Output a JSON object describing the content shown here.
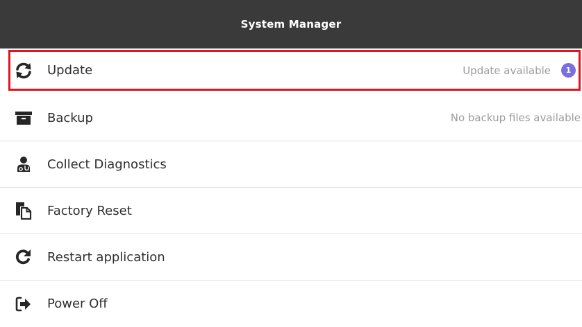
{
  "header": {
    "title": "System Manager"
  },
  "menu": {
    "items": [
      {
        "label": "Update",
        "status": "Update available",
        "badge": "1",
        "icon": "refresh-icon",
        "selected": true
      },
      {
        "label": "Backup",
        "status": "No backup files available",
        "icon": "archive-box-icon"
      },
      {
        "label": "Collect Diagnostics",
        "icon": "doctor-icon"
      },
      {
        "label": "Factory Reset",
        "icon": "copy-files-icon"
      },
      {
        "label": "Restart application",
        "icon": "restart-icon"
      },
      {
        "label": "Power Off",
        "icon": "sign-out-icon"
      }
    ]
  },
  "colors": {
    "header_bg": "#3a3a3a",
    "selection_border": "#e0141e",
    "badge_bg": "#7b6ee0",
    "status_text": "#9b9b9b"
  }
}
